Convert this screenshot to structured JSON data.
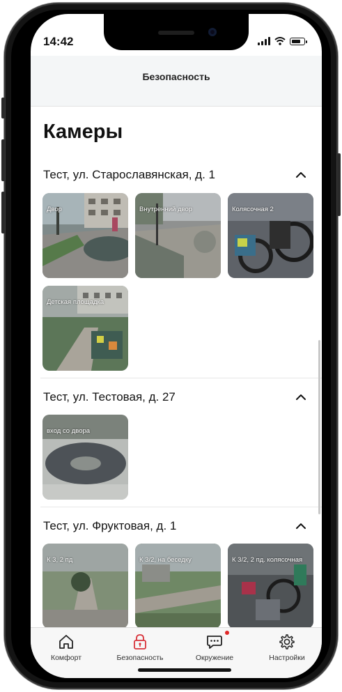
{
  "status_bar": {
    "time": "14:42"
  },
  "header": {
    "title": "Безопасность"
  },
  "page": {
    "title": "Камеры"
  },
  "sections": [
    {
      "title": "Тест, ул. Старославянская, д. 1",
      "cameras": [
        "Двор",
        "Внутренний двор",
        "Колясочная 2",
        "Детская площадка"
      ]
    },
    {
      "title": "Тест, ул. Тестовая, д. 27",
      "cameras": [
        "вход со двора"
      ]
    },
    {
      "title": "Тест, ул. Фруктовая, д. 1",
      "cameras": [
        "К 3, 2 пд",
        "К 3/2, на беседку",
        "К 3/2, 2 пд. колясочная"
      ]
    }
  ],
  "tabs": [
    {
      "label": "Комфорт",
      "icon": "home-icon"
    },
    {
      "label": "Безопасность",
      "icon": "lock-icon"
    },
    {
      "label": "Окружение",
      "icon": "chat-icon"
    },
    {
      "label": "Настройки",
      "icon": "gear-icon"
    }
  ],
  "colors": {
    "accent": "#d8323a",
    "notification": "#e02828",
    "text": "#111111"
  }
}
